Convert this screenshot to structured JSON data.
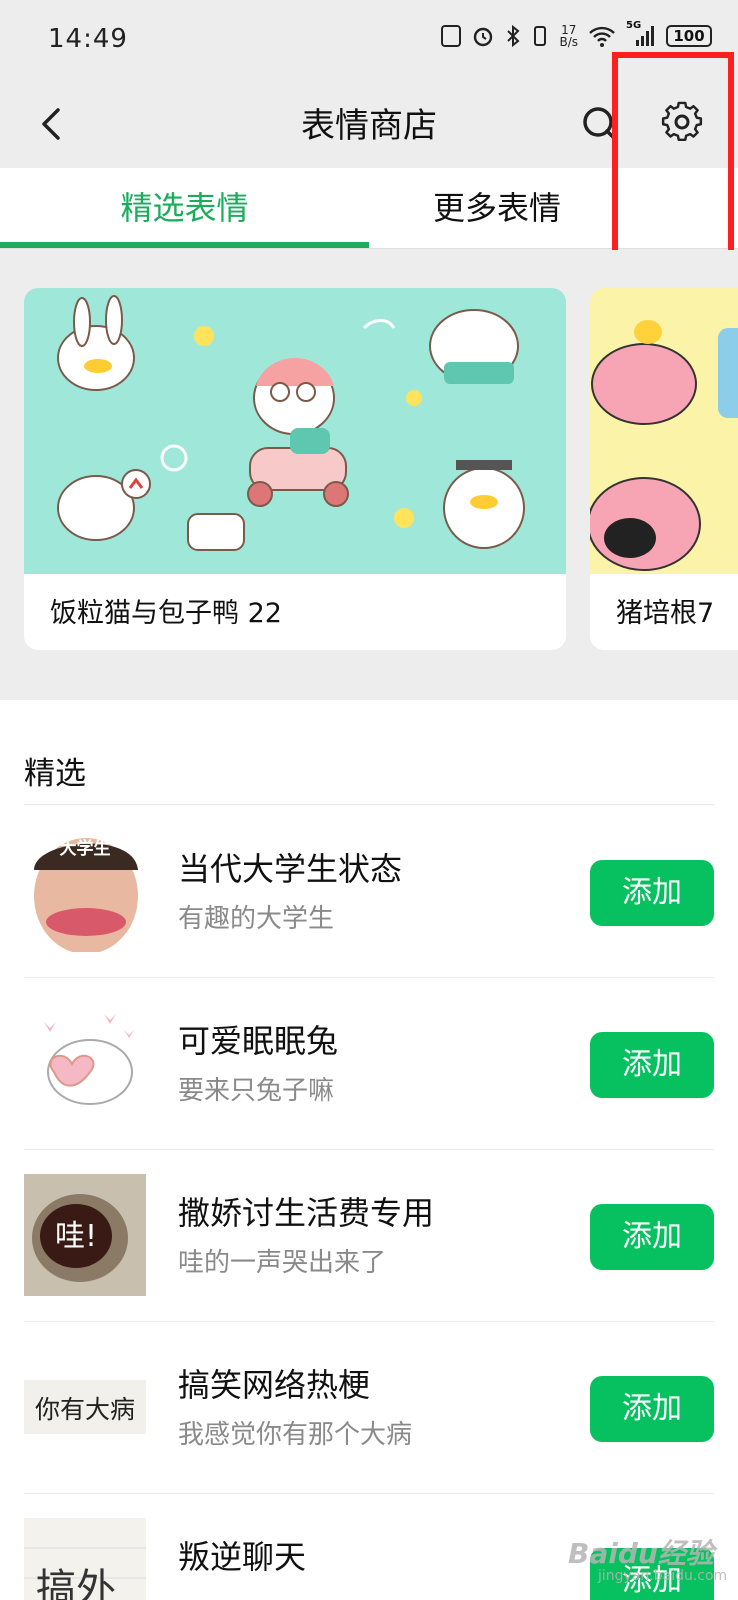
{
  "status_bar": {
    "time": "14:49",
    "net_speed_value": "17",
    "net_speed_unit": "B/s",
    "network_label": "5G",
    "battery": "100"
  },
  "nav": {
    "title": "表情商店"
  },
  "tabs": [
    {
      "label": "精选表情",
      "active": true
    },
    {
      "label": "更多表情",
      "active": false
    }
  ],
  "banners": [
    {
      "label": "饭粒猫与包子鸭 22"
    },
    {
      "label": "猪培根7"
    }
  ],
  "featured": {
    "section_title": "精选",
    "items": [
      {
        "title": "当代大学生状态",
        "subtitle": "有趣的大学生",
        "button": "添加",
        "thumb_caption": "大学生"
      },
      {
        "title": "可爱眠眠兔",
        "subtitle": "要来只兔子嘛",
        "button": "添加"
      },
      {
        "title": "撒娇讨生活费专用",
        "subtitle": "哇的一声哭出来了",
        "button": "添加",
        "thumb_caption": "哇!"
      },
      {
        "title": "搞笑网络热梗",
        "subtitle": "我感觉你有那个大病",
        "button": "添加",
        "thumb_caption": "你有大病"
      },
      {
        "title": "叛逆聊天",
        "subtitle": "",
        "button": "添加",
        "thumb_caption": "搞外"
      }
    ]
  },
  "colors": {
    "accent_green": "#1aad5b",
    "button_green": "#07c160",
    "highlight_red": "#ff1f1f"
  },
  "watermark": {
    "text": "Baidu经验",
    "sub": "jingyan.baidu.com"
  }
}
